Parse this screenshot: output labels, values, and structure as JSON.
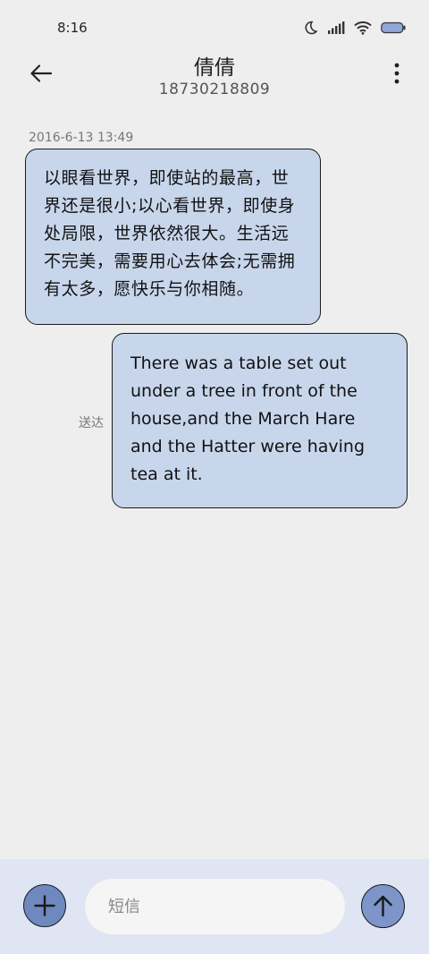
{
  "status_bar": {
    "time": "8:16"
  },
  "header": {
    "title": "倩倩",
    "subtitle": "18730218809"
  },
  "conversation": {
    "timestamp": "2016-6-13 13:49",
    "messages": [
      {
        "direction": "incoming",
        "text": "以眼看世界，即使站的最高，世界还是很小;以心看世界，即使身处局限，世界依然很大。生活远不完美，需要用心去体会;无需拥有太多，愿快乐与你相随。"
      },
      {
        "direction": "outgoing",
        "text": "There was a table set out under a tree in front of the house,and the March Hare and the Hatter were having tea at it.",
        "status": "送达"
      }
    ]
  },
  "composer": {
    "placeholder": "短信"
  },
  "icons": {
    "back": "arrow-left-icon",
    "more": "more-vertical-icon",
    "add": "plus-icon",
    "send": "arrow-up-icon",
    "status": [
      "moon-icon",
      "signal-icon",
      "wifi-icon",
      "battery-icon"
    ]
  },
  "colors": {
    "bubble": "#c8d6ec",
    "add_button": "#6f88bf",
    "send_button": "#7d95c8",
    "bottom_bar": "#dfe5f2"
  }
}
